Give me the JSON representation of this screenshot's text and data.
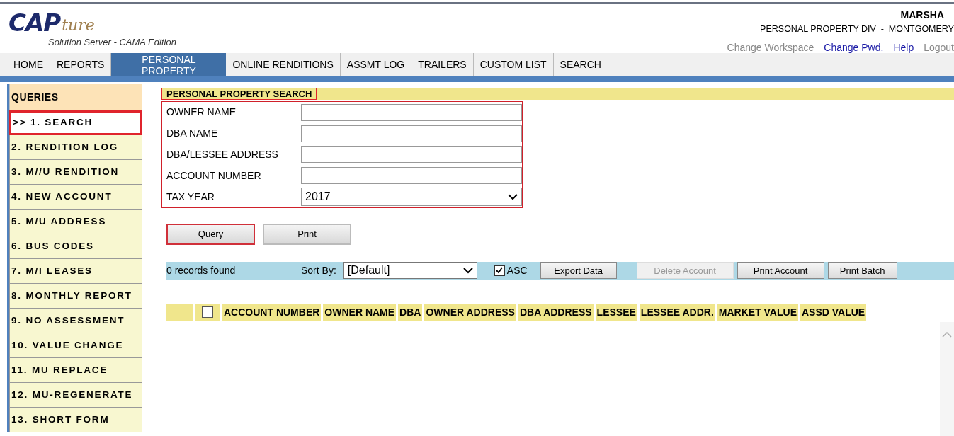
{
  "logo": {
    "main": "CAP",
    "script": "ture",
    "subtitle": "Solution Server - CAMA Edition"
  },
  "user": {
    "name": "MARSHA",
    "division": "PERSONAL PROPERTY DIV  -  MONTGOMERY"
  },
  "header_links": [
    {
      "label": "Change Workspace",
      "disabled": true
    },
    {
      "label": "Change Pwd.",
      "disabled": false
    },
    {
      "label": "Help",
      "disabled": false
    },
    {
      "label": "Logout",
      "disabled": true
    }
  ],
  "tabs": [
    {
      "label": "HOME",
      "selected": false
    },
    {
      "label": "REPORTS",
      "selected": false
    },
    {
      "label": "PERSONAL PROPERTY",
      "selected": true
    },
    {
      "label": "ONLINE RENDITIONS",
      "selected": false
    },
    {
      "label": "ASSMT LOG",
      "selected": false
    },
    {
      "label": "TRAILERS",
      "selected": false
    },
    {
      "label": "CUSTOM LIST",
      "selected": false
    },
    {
      "label": "SEARCH",
      "selected": false
    }
  ],
  "sidebar": {
    "title": "QUERIES",
    "items": [
      {
        "label": ">> 1. SEARCH",
        "selected": true
      },
      {
        "label": "2. RENDITION LOG",
        "selected": false
      },
      {
        "label": "3. M//U RENDITION",
        "selected": false
      },
      {
        "label": "4. NEW ACCOUNT",
        "selected": false
      },
      {
        "label": "5. M/U ADDRESS",
        "selected": false
      },
      {
        "label": "6. BUS CODES",
        "selected": false
      },
      {
        "label": "7. M/I LEASES",
        "selected": false
      },
      {
        "label": "8. MONTHLY REPORT",
        "selected": false
      },
      {
        "label": "9. NO ASSESSMENT",
        "selected": false
      },
      {
        "label": "10. VALUE CHANGE",
        "selected": false
      },
      {
        "label": "11. MU REPLACE",
        "selected": false
      },
      {
        "label": "12. MU-REGENERATE",
        "selected": false
      },
      {
        "label": "13. SHORT FORM",
        "selected": false
      }
    ]
  },
  "search": {
    "title": "PERSONAL PROPERTY SEARCH",
    "fields": [
      {
        "label": "OWNER NAME",
        "kind": "text"
      },
      {
        "label": "DBA NAME",
        "kind": "text"
      },
      {
        "label": "DBA/LESSEE ADDRESS",
        "kind": "text"
      },
      {
        "label": "ACCOUNT NUMBER",
        "kind": "text"
      },
      {
        "label": "TAX YEAR",
        "kind": "select",
        "value": "2017"
      }
    ],
    "buttons": [
      {
        "label": "Query",
        "focused": true
      },
      {
        "label": "Print",
        "focused": false
      }
    ]
  },
  "results_bar": {
    "count": "0 records found",
    "sort_label": "Sort By:",
    "sort_value": "[Default]",
    "asc": {
      "label": "ASC",
      "checked": true
    },
    "buttons": [
      {
        "label": "Export Data",
        "disabled": false
      },
      {
        "label": "Delete Account",
        "disabled": true
      },
      {
        "label": "Print Account",
        "disabled": false
      },
      {
        "label": "Print Batch",
        "disabled": false
      }
    ]
  },
  "table": {
    "select_all_checked": false,
    "columns": [
      "ACCOUNT NUMBER",
      "OWNER NAME",
      "DBA",
      "OWNER ADDRESS",
      "DBA ADDRESS",
      "LESSEE",
      "LESSEE ADDR.",
      "MARKET VALUE",
      "ASSD VALUE"
    ]
  }
}
